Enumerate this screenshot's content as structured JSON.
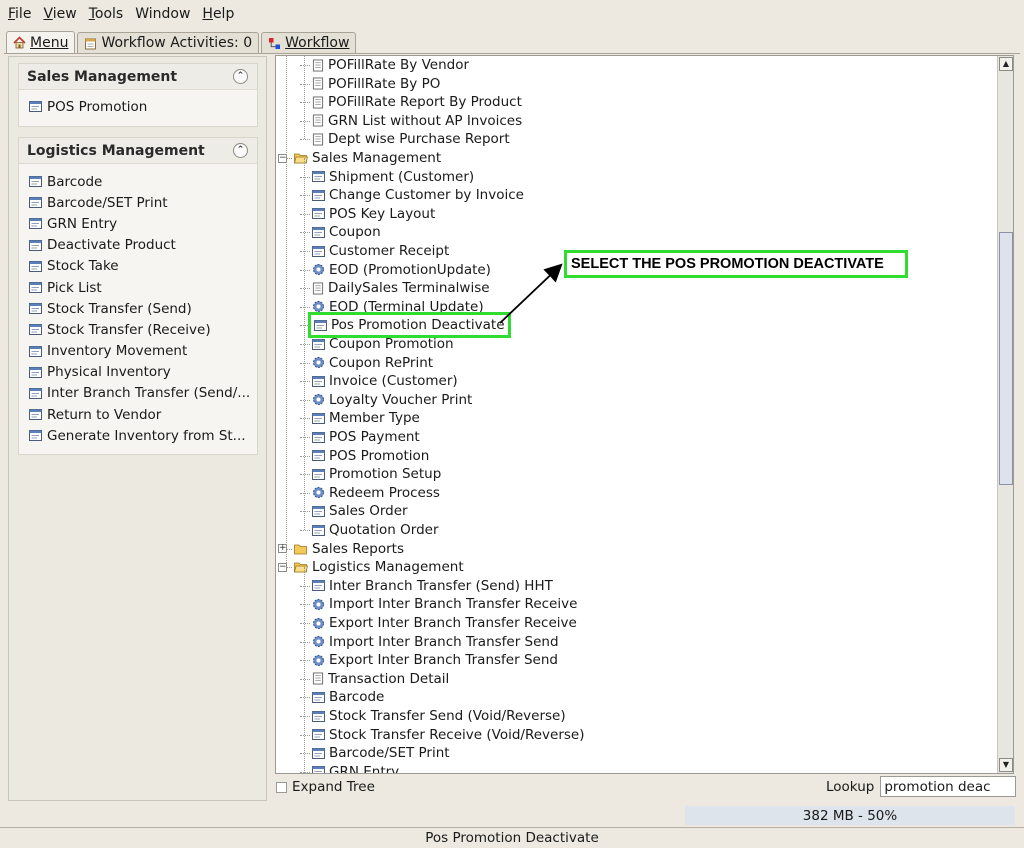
{
  "menubar": {
    "items": [
      {
        "first": "F",
        "rest": "ile"
      },
      {
        "first": "V",
        "rest": "iew"
      },
      {
        "first": "T",
        "rest": "ools"
      },
      {
        "first": "",
        "rest": "Window"
      },
      {
        "first": "H",
        "rest": "elp"
      }
    ]
  },
  "tabs": {
    "menu": "Menu",
    "workflow_activities": "Workflow Activities: 0",
    "workflow": "Workflow"
  },
  "left": {
    "sales_title": "Sales Management",
    "sales_items": [
      "POS Promotion"
    ],
    "logistics_title": "Logistics Management",
    "logistics_items": [
      "Barcode",
      "Barcode/SET Print",
      "GRN Entry",
      "Deactivate Product",
      "Stock Take",
      "Pick List",
      "Stock Transfer (Send)",
      "Stock Transfer (Receive)",
      "Inventory Movement",
      "Physical Inventory",
      "Inter Branch Transfer (Send/...",
      "Return to Vendor",
      "Generate Inventory from St..."
    ]
  },
  "tree": {
    "rows": [
      {
        "label": "POFillRate By Vendor",
        "icon": "report"
      },
      {
        "label": "POFillRate By PO",
        "icon": "report"
      },
      {
        "label": "POFillRate Report By Product",
        "icon": "report"
      },
      {
        "label": "GRN List without AP Invoices",
        "icon": "report"
      },
      {
        "label": "Dept wise Purchase Report",
        "icon": "report"
      },
      {
        "label": "Sales Management",
        "icon": "folder-open",
        "folder": true
      },
      {
        "label": "Shipment (Customer)",
        "icon": "window"
      },
      {
        "label": "Change Customer by Invoice",
        "icon": "window"
      },
      {
        "label": "POS Key Layout",
        "icon": "window"
      },
      {
        "label": "Coupon",
        "icon": "window"
      },
      {
        "label": "Customer Receipt",
        "icon": "window"
      },
      {
        "label": "EOD (PromotionUpdate)",
        "icon": "process"
      },
      {
        "label": "DailySales Terminalwise",
        "icon": "report"
      },
      {
        "label": "EOD (Terminal Update)",
        "icon": "process"
      },
      {
        "label": "Pos Promotion Deactivate",
        "icon": "window",
        "selected": true
      },
      {
        "label": "Coupon Promotion",
        "icon": "window"
      },
      {
        "label": "Coupon RePrint",
        "icon": "process"
      },
      {
        "label": "Invoice (Customer)",
        "icon": "window"
      },
      {
        "label": "Loyalty Voucher Print",
        "icon": "process"
      },
      {
        "label": "Member Type",
        "icon": "window"
      },
      {
        "label": "POS Payment",
        "icon": "window"
      },
      {
        "label": "POS Promotion",
        "icon": "window"
      },
      {
        "label": "Promotion Setup",
        "icon": "window"
      },
      {
        "label": "Redeem Process",
        "icon": "process"
      },
      {
        "label": "Sales Order",
        "icon": "window"
      },
      {
        "label": "Quotation Order",
        "icon": "window"
      },
      {
        "label": "Sales Reports",
        "icon": "folder-closed",
        "folder": true
      },
      {
        "label": "Logistics Management",
        "icon": "folder-open",
        "folder": true
      },
      {
        "label": "Inter Branch Transfer (Send) HHT",
        "icon": "window"
      },
      {
        "label": "Import Inter Branch Transfer Receive",
        "icon": "process"
      },
      {
        "label": "Export Inter Branch Transfer Receive",
        "icon": "process"
      },
      {
        "label": "Import Inter Branch Transfer Send",
        "icon": "process"
      },
      {
        "label": "Export Inter Branch Transfer Send",
        "icon": "process"
      },
      {
        "label": "Transaction Detail",
        "icon": "report"
      },
      {
        "label": "Barcode",
        "icon": "window"
      },
      {
        "label": "Stock Transfer Send (Void/Reverse)",
        "icon": "window"
      },
      {
        "label": "Stock Transfer Receive (Void/Reverse)",
        "icon": "window"
      },
      {
        "label": "Barcode/SET Print",
        "icon": "window"
      },
      {
        "label": "GRN Entry",
        "icon": "window"
      }
    ]
  },
  "bottom": {
    "expand_tree": "Expand Tree",
    "lookup_label": "Lookup",
    "lookup_value": "promotion deac",
    "memory": "382 MB - 50%",
    "status": "Pos Promotion Deactivate"
  },
  "annotation": {
    "callout": "SELECT THE POS PROMOTION DEACTIVATE",
    "color": "#2fdc2f"
  }
}
